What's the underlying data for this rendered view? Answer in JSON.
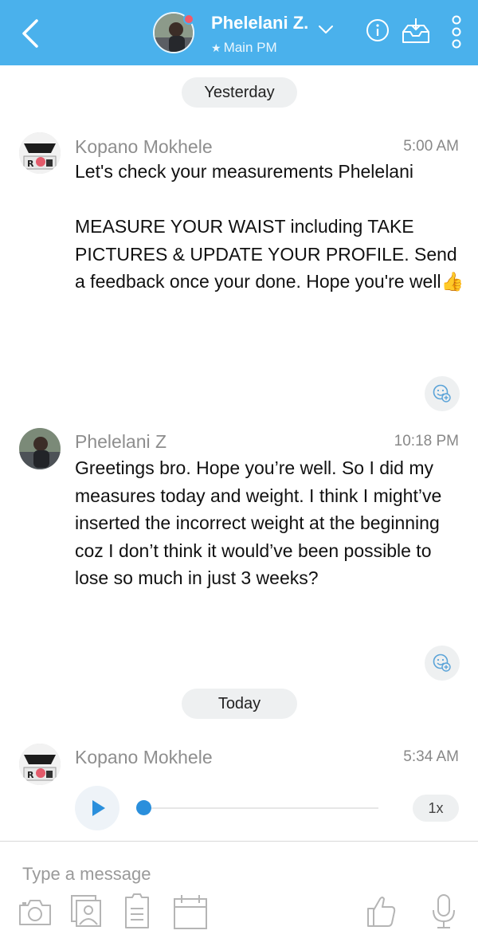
{
  "header": {
    "contact_name": "Phelelani Z.",
    "subtitle": "Main PM",
    "status_color": "#f25a6a",
    "accent_color": "#4ab1ec",
    "icons": [
      "back-arrow-icon",
      "chevron-down-icon",
      "info-icon",
      "inbox-download-icon",
      "more-vertical-icon"
    ]
  },
  "dividers": {
    "yesterday": "Yesterday",
    "today": "Today"
  },
  "messages": [
    {
      "sender": "Kopano Mokhele",
      "time": "5:00 AM",
      "text": "Let's check your measurements Phelelani\n\nMEASURE YOUR WAIST including TAKE PICTURES & UPDATE YOUR PROFILE. Send a feedback once your done. Hope you're well",
      "emoji": "👍"
    },
    {
      "sender": "Phelelani Z",
      "time": "10:18 PM",
      "text": "Greetings bro. Hope you’re well. So I did my measures today and weight. I think I might’ve inserted the incorrect weight at the beginning coz I don’t think it would’ve been possible to lose so much in just 3 weeks?"
    },
    {
      "sender": "Kopano Mokhele",
      "time": "5:34 AM",
      "audio": {
        "speed": "1x",
        "progress": 0
      }
    }
  ],
  "composer": {
    "placeholder": "Type a message",
    "tools": [
      "camera-icon",
      "image-gallery-icon",
      "document-icon",
      "calendar-icon",
      "thumbs-up-icon",
      "microphone-icon"
    ]
  }
}
